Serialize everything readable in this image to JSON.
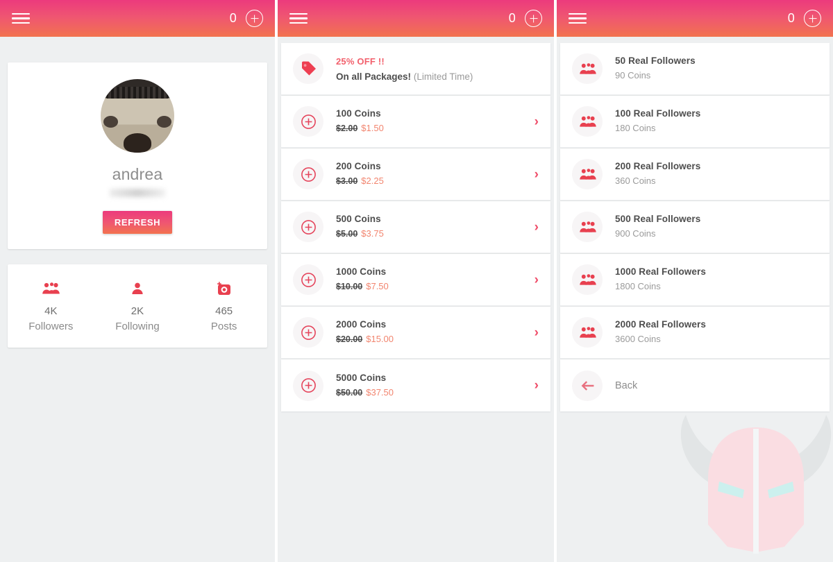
{
  "appbar": {
    "menu_icon": "hamburger-menu-icon",
    "coin_count": "0",
    "add_icon": "plus-circle-icon"
  },
  "profile": {
    "avatar_icon": "user-avatar-photo",
    "username": "andrea",
    "fullname_redacted": "",
    "refresh_label": "REFRESH",
    "stats": [
      {
        "icon": "followers-group-icon",
        "value": "4K",
        "label": "Followers"
      },
      {
        "icon": "following-person-icon",
        "value": "2K",
        "label": "Following"
      },
      {
        "icon": "posts-camera-icon",
        "value": "465",
        "label": "Posts"
      }
    ]
  },
  "coins_panel": {
    "promo": {
      "icon": "price-tag-icon",
      "headline": "25% OFF !!",
      "subline_bold": "On all Packages!",
      "subline_muted": "(Limited Time)"
    },
    "packages": [
      {
        "icon": "plus-circle-icon",
        "title": "100 Coins",
        "old_price": "$2.00",
        "new_price": "$1.50",
        "chevron": "chevron-right-icon"
      },
      {
        "icon": "plus-circle-icon",
        "title": "200 Coins",
        "old_price": "$3.00",
        "new_price": "$2.25",
        "chevron": "chevron-right-icon"
      },
      {
        "icon": "plus-circle-icon",
        "title": "500 Coins",
        "old_price": "$5.00",
        "new_price": "$3.75",
        "chevron": "chevron-right-icon"
      },
      {
        "icon": "plus-circle-icon",
        "title": "1000 Coins",
        "old_price": "$10.00",
        "new_price": "$7.50",
        "chevron": "chevron-right-icon"
      },
      {
        "icon": "plus-circle-icon",
        "title": "2000 Coins",
        "old_price": "$20.00",
        "new_price": "$15.00",
        "chevron": "chevron-right-icon"
      },
      {
        "icon": "plus-circle-icon",
        "title": "5000 Coins",
        "old_price": "$50.00",
        "new_price": "$37.50",
        "chevron": "chevron-right-icon"
      }
    ]
  },
  "followers_panel": {
    "packages": [
      {
        "icon": "followers-group-icon",
        "title": "50 Real Followers",
        "cost": "90 Coins"
      },
      {
        "icon": "followers-group-icon",
        "title": "100 Real Followers",
        "cost": "180 Coins"
      },
      {
        "icon": "followers-group-icon",
        "title": "200 Real Followers",
        "cost": "360 Coins"
      },
      {
        "icon": "followers-group-icon",
        "title": "500 Real Followers",
        "cost": "900 Coins"
      },
      {
        "icon": "followers-group-icon",
        "title": "1000 Real Followers",
        "cost": "1800 Coins"
      },
      {
        "icon": "followers-group-icon",
        "title": "2000 Real Followers",
        "cost": "3600 Coins"
      }
    ],
    "back": {
      "icon": "arrow-left-icon",
      "label": "Back"
    }
  },
  "watermark": {
    "icon": "viking-helmet-logo"
  },
  "colors": {
    "gradient_start": "#ec3a7d",
    "gradient_end": "#f2734f",
    "accent_red": "#ef4e6a",
    "icon_red": "#e8404f",
    "price_new": "#f2856f",
    "background": "#eef0f1",
    "card": "#ffffff",
    "text_dark": "#4d4d4d",
    "text_muted": "#9a9a9a"
  }
}
